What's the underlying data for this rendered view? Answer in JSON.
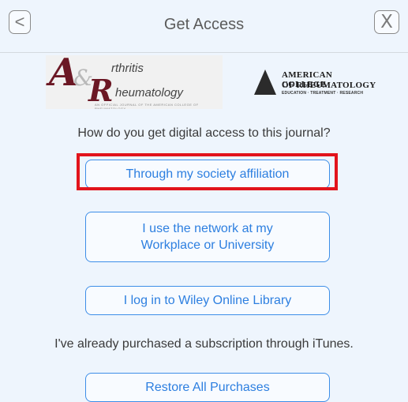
{
  "header": {
    "title": "Get Access",
    "back_glyph": "<",
    "close_glyph": "X"
  },
  "logos": {
    "journal": {
      "letter1": "A",
      "letter2": "R",
      "ampersand": "&",
      "word1": "rthritis",
      "word2": "heumatology",
      "tagline": "AN OFFICIAL JOURNAL OF THE AMERICAN COLLEGE OF RHEUMATOLOGY"
    },
    "college": {
      "line1": "AMERICAN COLLEGE",
      "line2": "OF RHEUMATOLOGY",
      "line3": "EDUCATION · TREATMENT · RESEARCH"
    }
  },
  "question": "How do you get digital access to this journal?",
  "buttons": {
    "society": "Through my society affiliation",
    "network_line1": "I use the network at my",
    "network_line2": "Workplace or University",
    "wiley": "I log in to Wiley Online Library",
    "restore": "Restore All Purchases"
  },
  "itunes_text": "I've already purchased a subscription through iTunes.",
  "colors": {
    "background": "#eef5fd",
    "accent": "#2d7fe0",
    "highlight": "#e2141c",
    "journal_brand": "#6b1724"
  }
}
